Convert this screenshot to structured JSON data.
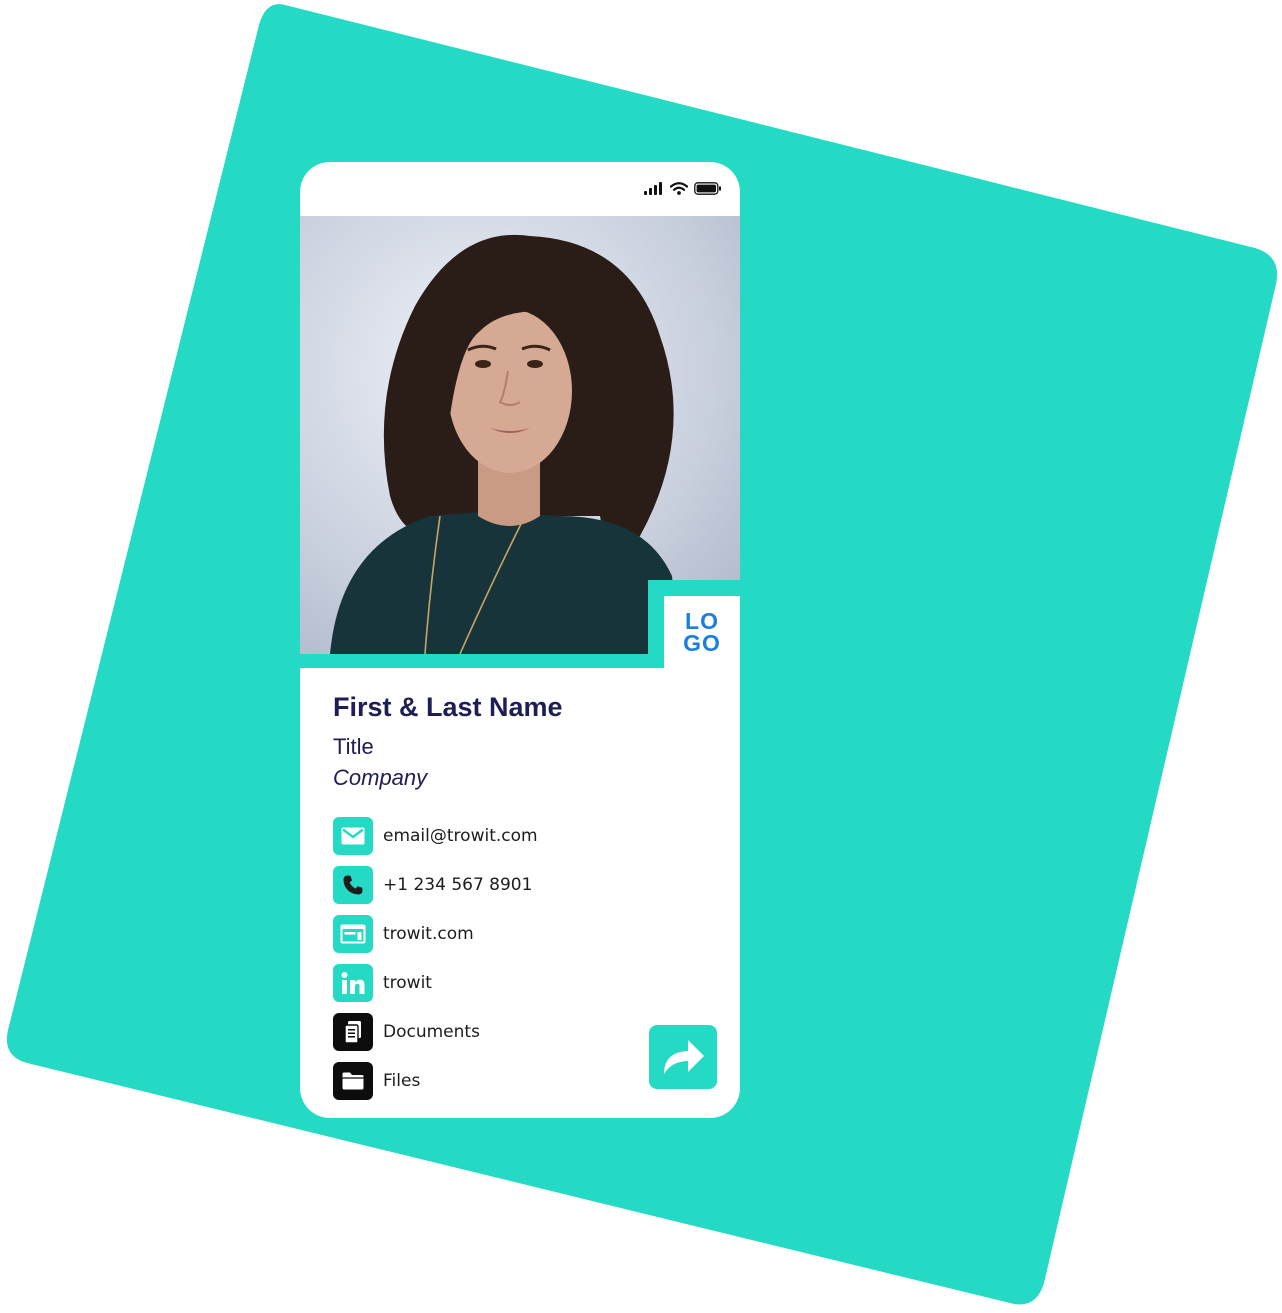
{
  "colors": {
    "accent": "#25dac4",
    "name_text": "#1f1d55",
    "logo_blue": "#1a7fe0",
    "contact_text": "#1c1c1c"
  },
  "status_bar": {
    "icons": [
      "signal-icon",
      "wifi-icon",
      "battery-icon"
    ]
  },
  "profile": {
    "photo": "portrait-photo",
    "logo_lines": [
      "LO",
      "GO"
    ],
    "name": "First & Last Name",
    "title": "Title",
    "company": "Company"
  },
  "contacts": [
    {
      "icon": "email-icon",
      "label": "email@trowit.com"
    },
    {
      "icon": "phone-icon",
      "label": "+1 234 567 8901"
    },
    {
      "icon": "website-icon",
      "label": "trowit.com"
    },
    {
      "icon": "linkedin-icon",
      "label": "trowit"
    },
    {
      "icon": "documents-icon",
      "label": "Documents"
    },
    {
      "icon": "files-icon",
      "label": "Files"
    }
  ],
  "share": {
    "icon": "share-arrow-icon"
  }
}
